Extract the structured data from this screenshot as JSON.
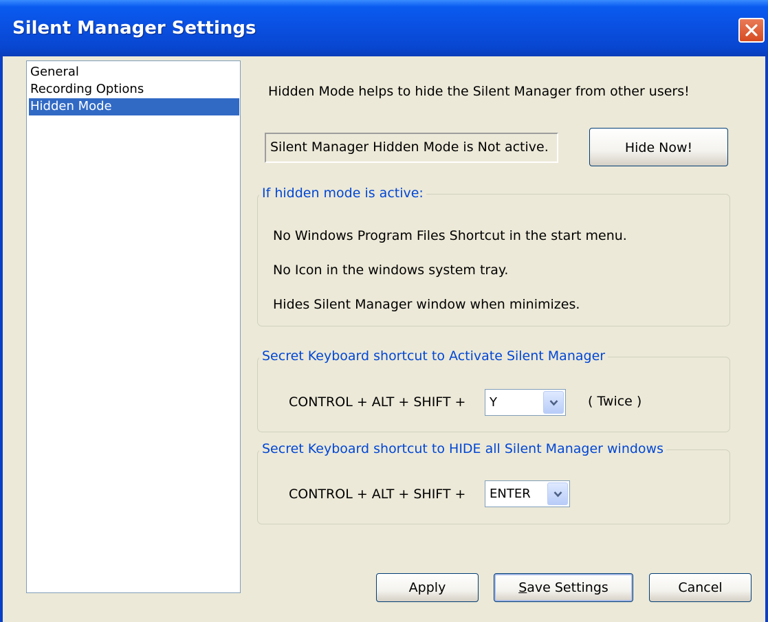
{
  "window": {
    "title": "Silent Manager Settings"
  },
  "nav": {
    "items": [
      "General",
      "Recording Options",
      "Hidden Mode"
    ],
    "selected_index": 2
  },
  "main": {
    "info_text": "Hidden Mode helps to hide the Silent Manager from other users!",
    "status_text": "Silent Manager Hidden Mode is Not active.",
    "hide_now_label": "Hide Now!",
    "active_group": {
      "legend": "If hidden mode is active:",
      "lines": [
        "No Windows Program Files Shortcut in the start menu.",
        "No Icon in the windows system tray.",
        "Hides Silent Manager window when minimizes."
      ]
    },
    "activate_group": {
      "legend": "Secret Keyboard shortcut to Activate Silent Manager",
      "prefix": "CONTROL + ALT + SHIFT +",
      "key_value": "Y",
      "suffix": "( Twice )"
    },
    "hide_group": {
      "legend": "Secret Keyboard shortcut to HIDE all Silent Manager windows",
      "prefix": "CONTROL + ALT + SHIFT +",
      "key_value": "ENTER"
    }
  },
  "footer": {
    "apply_label": "Apply",
    "save_label_mnemonic": "S",
    "save_label_rest": "ave Settings",
    "cancel_label": "Cancel"
  },
  "colors": {
    "titlebar": "#0a4fe0",
    "client_bg": "#ece9d8",
    "selection": "#316ac5",
    "legend_text": "#0046d5",
    "close_button": "#d64b22"
  },
  "icons": {
    "close": "close-x-icon",
    "dropdown": "chevron-down-icon"
  }
}
